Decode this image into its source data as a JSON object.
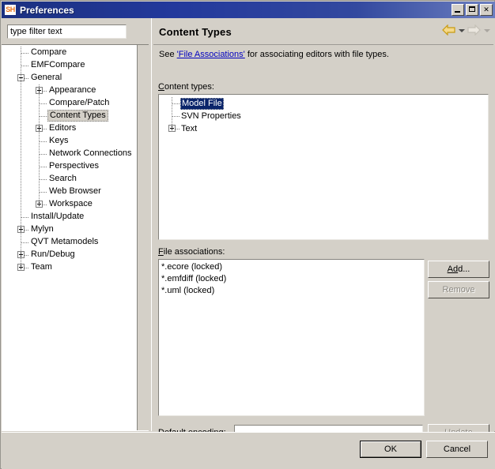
{
  "window": {
    "title": "Preferences",
    "icon": "sh-app-icon",
    "icon_text": "SH",
    "controls": {
      "minimize": "minimize-icon",
      "maximize": "maximize-icon",
      "close": "✕"
    },
    "accent_titlebar": "#1b3080"
  },
  "sidebar": {
    "filter": {
      "value": "type filter text",
      "placeholder": "type filter text"
    },
    "items": [
      {
        "label": "Compare",
        "indent": 0,
        "expander": "none"
      },
      {
        "label": "EMFCompare",
        "indent": 0,
        "expander": "none"
      },
      {
        "label": "General",
        "indent": 0,
        "expander": "minus"
      },
      {
        "label": "Appearance",
        "indent": 1,
        "expander": "plus"
      },
      {
        "label": "Compare/Patch",
        "indent": 1,
        "expander": "none"
      },
      {
        "label": "Content Types",
        "indent": 1,
        "expander": "none",
        "selected": true
      },
      {
        "label": "Editors",
        "indent": 1,
        "expander": "plus"
      },
      {
        "label": "Keys",
        "indent": 1,
        "expander": "none"
      },
      {
        "label": "Network Connections",
        "indent": 1,
        "expander": "none"
      },
      {
        "label": "Perspectives",
        "indent": 1,
        "expander": "none"
      },
      {
        "label": "Search",
        "indent": 1,
        "expander": "none"
      },
      {
        "label": "Web Browser",
        "indent": 1,
        "expander": "none"
      },
      {
        "label": "Workspace",
        "indent": 1,
        "expander": "plus"
      },
      {
        "label": "Install/Update",
        "indent": 0,
        "expander": "none"
      },
      {
        "label": "Mylyn",
        "indent": 0,
        "expander": "plus"
      },
      {
        "label": "QVT Metamodels",
        "indent": 0,
        "expander": "none"
      },
      {
        "label": "Run/Debug",
        "indent": 0,
        "expander": "plus"
      },
      {
        "label": "Team",
        "indent": 0,
        "expander": "plus"
      }
    ]
  },
  "page": {
    "title": "Content Types",
    "nav": {
      "back_icon": "back-arrow-icon",
      "back_enabled": true,
      "forward_icon": "forward-arrow-icon",
      "forward_enabled": false,
      "back_color": "#e0a800",
      "forward_color": "#d8d4cc"
    },
    "hint": {
      "prefix": "See ",
      "link": "'File Associations'",
      "suffix": " for associating editors with file types."
    },
    "content_types": {
      "label_pre": "C",
      "label_post": "ontent types:",
      "items": [
        {
          "label": "Model File",
          "expander": "none",
          "selected": true
        },
        {
          "label": "SVN Properties",
          "expander": "none",
          "selected": false
        },
        {
          "label": "Text",
          "expander": "plus",
          "selected": false
        }
      ]
    },
    "file_associations": {
      "label_pre": "F",
      "label_post": "ile associations:",
      "items": [
        "*.ecore (locked)",
        "*.emfdiff (locked)",
        "*.uml (locked)"
      ]
    },
    "buttons": {
      "add": {
        "pre": "A",
        "mn": "d",
        "post": "d...",
        "label": "Add...",
        "enabled": true
      },
      "remove": {
        "label": "Remove",
        "mnemonic": "R",
        "enabled": false
      },
      "update": {
        "label": "Update",
        "mnemonic": "U",
        "enabled": false
      }
    },
    "default_encoding": {
      "label_a": "Default ",
      "label_mn": "e",
      "label_b": "ncoding:",
      "value": "",
      "placeholder": ""
    }
  },
  "footer": {
    "ok": "OK",
    "cancel": "Cancel"
  }
}
